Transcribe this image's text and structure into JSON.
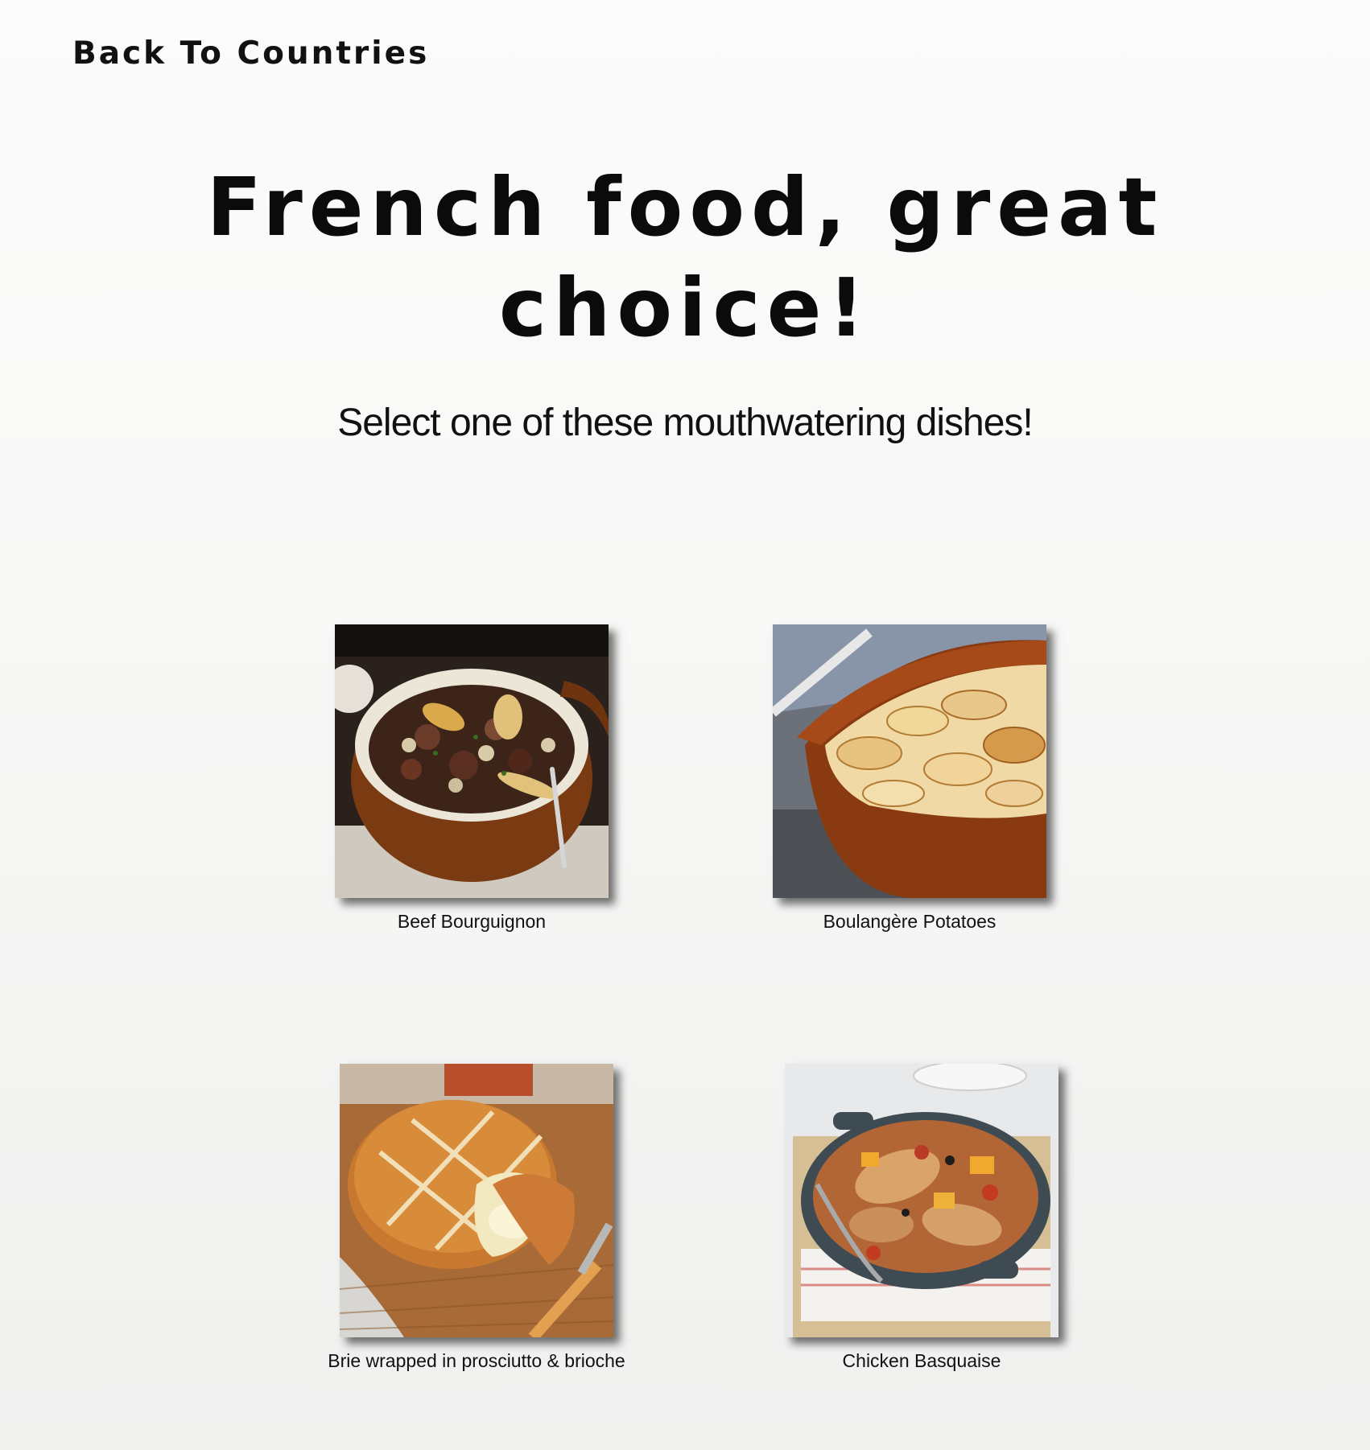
{
  "nav": {
    "back_label": "Back To Countries"
  },
  "header": {
    "title_line1": "French food, great",
    "title_line2": "choice!",
    "subtitle": "Select one of these mouthwatering dishes!"
  },
  "dishes": [
    {
      "name": "Beef Bourguignon",
      "icon": "beef-bourguignon-photo"
    },
    {
      "name": "Boulangère Potatoes",
      "icon": "boulangere-potatoes-photo"
    },
    {
      "name": "Brie wrapped in prosciutto & brioche",
      "icon": "brie-brioche-photo"
    },
    {
      "name": "Chicken Basquaise",
      "icon": "chicken-basquaise-photo"
    }
  ]
}
